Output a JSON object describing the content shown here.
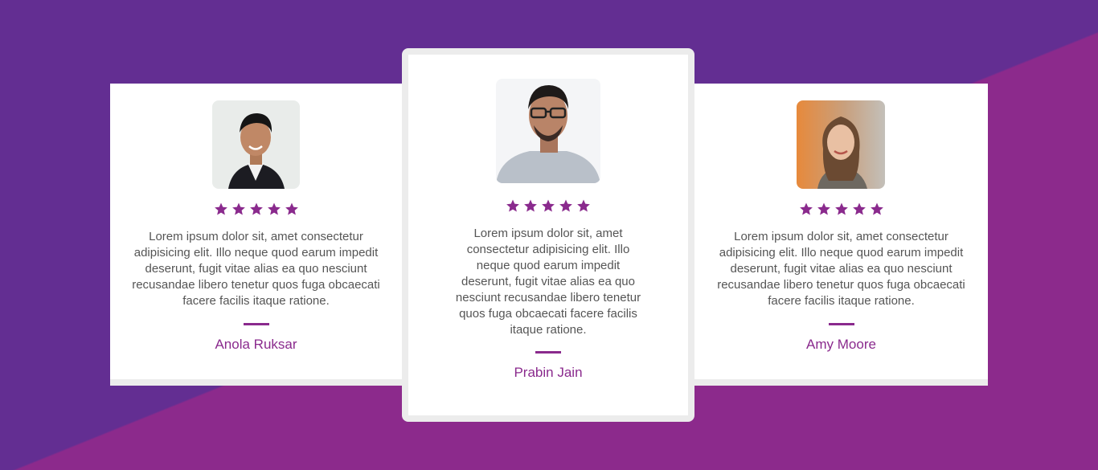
{
  "colors": {
    "background_primary": "#632e92",
    "background_secondary": "#8c2a8c",
    "card_background": "#ffffff",
    "card_border": "#ececec",
    "accent": "#8a2a8d",
    "text_body": "#555555"
  },
  "testimonials": [
    {
      "avatar_icon": "person-photo-icon",
      "rating": 5,
      "quote": "Lorem ipsum dolor sit, amet consectetur adipisicing elit. Illo neque quod earum impedit deserunt, fugit vitae alias ea quo nesciunt recusandae libero tenetur quos fuga obcaecati facere facilis itaque ratione.",
      "name": "Anola Ruksar"
    },
    {
      "avatar_icon": "person-photo-icon",
      "rating": 5,
      "quote": "Lorem ipsum dolor sit, amet consectetur adipisicing elit. Illo neque quod earum impedit deserunt, fugit vitae alias ea quo nesciunt recusandae libero tenetur quos fuga obcaecati facere facilis itaque ratione.",
      "name": "Prabin Jain"
    },
    {
      "avatar_icon": "person-photo-icon",
      "rating": 5,
      "quote": "Lorem ipsum dolor sit, amet consectetur adipisicing elit. Illo neque quod earum impedit deserunt, fugit vitae alias ea quo nesciunt recusandae libero tenetur quos fuga obcaecati facere facilis itaque ratione.",
      "name": "Amy Moore"
    }
  ]
}
